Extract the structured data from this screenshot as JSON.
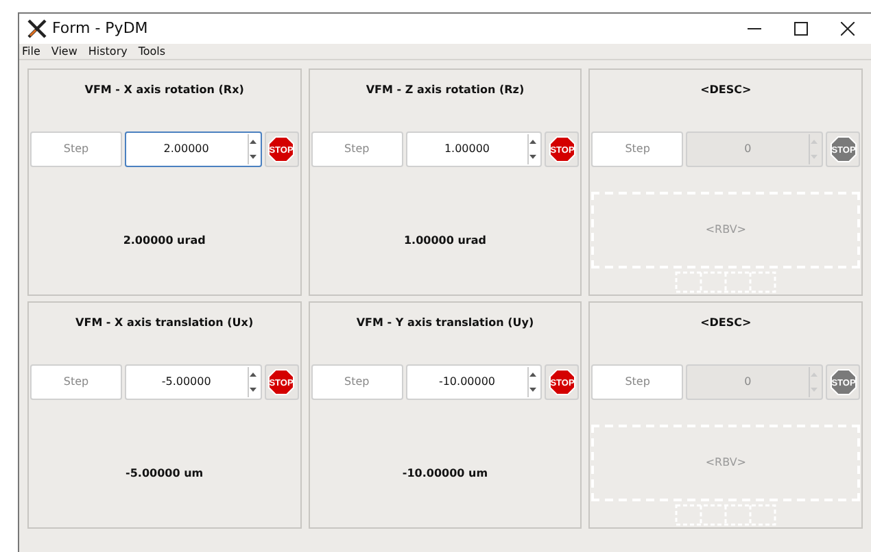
{
  "window": {
    "title": "Form - PyDM"
  },
  "menu": [
    "File",
    "View",
    "History",
    "Tools"
  ],
  "panels": [
    {
      "title": "VFM - X axis rotation (Rx)",
      "disabled": false,
      "focused": true,
      "step": "Step",
      "stop": "STOP",
      "value": "2.00000",
      "readback": "2.00000 urad"
    },
    {
      "title": "VFM - Z axis rotation (Rz)",
      "disabled": false,
      "focused": false,
      "step": "Step",
      "stop": "STOP",
      "value": "1.00000",
      "readback": "1.00000 urad"
    },
    {
      "title": "<DESC>",
      "disabled": true,
      "focused": false,
      "step": "Step",
      "stop": "STOP",
      "value": "0",
      "readback": "<RBV>"
    },
    {
      "title": "VFM - X axis translation (Ux)",
      "disabled": false,
      "focused": false,
      "step": "Step",
      "stop": "STOP",
      "value": "-5.00000",
      "readback": "-5.00000 um"
    },
    {
      "title": "VFM - Y axis translation (Uy)",
      "disabled": false,
      "focused": false,
      "step": "Step",
      "stop": "STOP",
      "value": "-10.00000",
      "readback": "-10.00000 um"
    },
    {
      "title": "<DESC>",
      "disabled": true,
      "focused": false,
      "step": "Step",
      "stop": "STOP",
      "value": "0",
      "readback": "<RBV>"
    }
  ]
}
